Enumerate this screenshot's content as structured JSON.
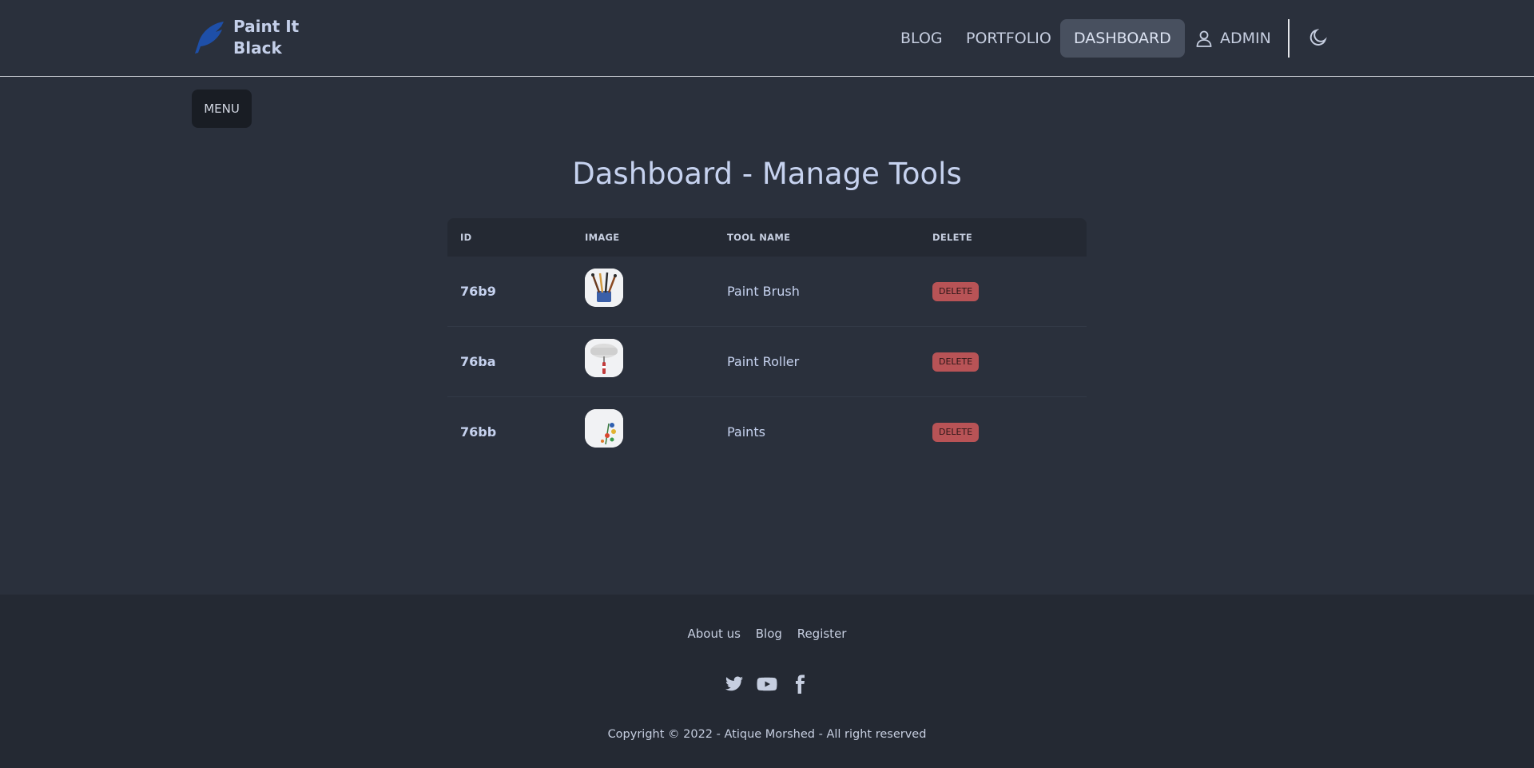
{
  "brand": {
    "name": "Paint It Black",
    "line1": "Paint It",
    "line2": "Black"
  },
  "nav": {
    "blog": "BLOG",
    "portfolio": "PORTFOLIO",
    "dashboard": "DASHBOARD",
    "admin": "ADMIN"
  },
  "menu_label": "MENU",
  "page_title": "Dashboard - Manage Tools",
  "table": {
    "headers": {
      "id": "ID",
      "image": "IMAGE",
      "name": "TOOL NAME",
      "delete": "DELETE"
    },
    "rows": [
      {
        "id": "76b9",
        "name": "Paint Brush",
        "delete": "DELETE",
        "image_icon": "paint-brush-image"
      },
      {
        "id": "76ba",
        "name": "Paint Roller",
        "delete": "DELETE",
        "image_icon": "paint-roller-image"
      },
      {
        "id": "76bb",
        "name": "Paints",
        "delete": "DELETE",
        "image_icon": "paints-image"
      }
    ]
  },
  "footer": {
    "links": {
      "about": "About us",
      "blog": "Blog",
      "register": "Register"
    },
    "social": [
      "twitter-icon",
      "youtube-icon",
      "facebook-icon"
    ],
    "copyright": "Copyright © 2022 - Atique Morshed - All right reserved"
  },
  "colors": {
    "background": "#2a303c",
    "footer": "#242933",
    "accent_text": "#c6d2ef",
    "delete_badge": "#b85356",
    "logo": "#1e4fa8"
  }
}
